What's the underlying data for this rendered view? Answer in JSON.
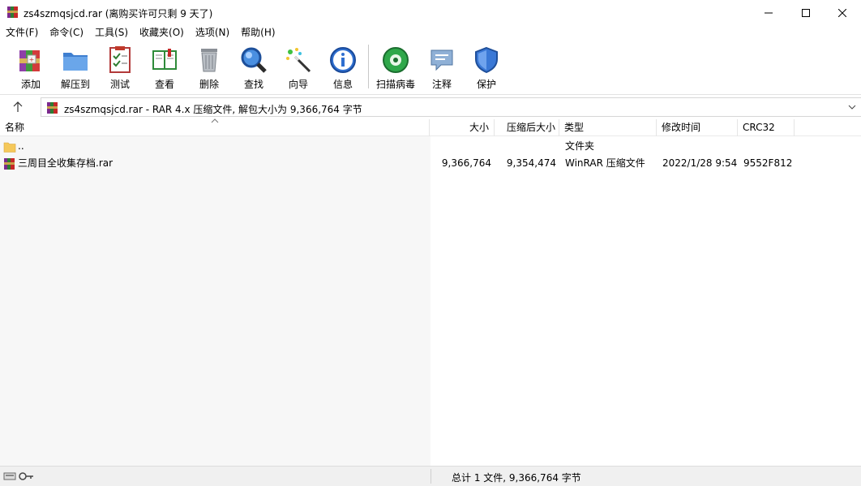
{
  "window": {
    "title": "zs4szmqsjcd.rar (离购买许可只剩 9 天了)"
  },
  "menu": [
    "文件(F)",
    "命令(C)",
    "工具(S)",
    "收藏夹(O)",
    "选项(N)",
    "帮助(H)"
  ],
  "toolbar": {
    "add": "添加",
    "extract": "解压到",
    "test": "测试",
    "view": "查看",
    "delete": "删除",
    "find": "查找",
    "wizard": "向导",
    "info": "信息",
    "virus_scan": "扫描病毒",
    "comment": "注释",
    "protect": "保护"
  },
  "address": {
    "path": "zs4szmqsjcd.rar - RAR 4.x 压缩文件, 解包大小为 9,366,764 字节"
  },
  "columns": {
    "name": "名称",
    "size": "大小",
    "packed": "压缩后大小",
    "type": "类型",
    "modified": "修改时间",
    "crc": "CRC32"
  },
  "rows": [
    {
      "name": "..",
      "size": "",
      "packed": "",
      "type": "文件夹",
      "modified": "",
      "crc": ""
    },
    {
      "name": "三周目全收集存档.rar",
      "size": "9,366,764",
      "packed": "9,354,474",
      "type": "WinRAR 压缩文件",
      "modified": "2022/1/28 9:54",
      "crc": "9552F812"
    }
  ],
  "status": {
    "summary": "总计 1 文件, 9,366,764 字节"
  },
  "colors": {
    "name_pane_bg": "#f7f7f7",
    "status_bg": "#f0f0f0",
    "folder": "#f5c85a"
  }
}
